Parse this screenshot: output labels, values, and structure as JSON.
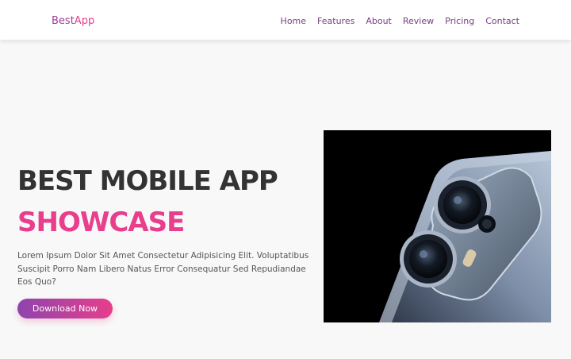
{
  "brand": {
    "part1": "Best",
    "part2": "App"
  },
  "nav": {
    "items": [
      "Home",
      "Features",
      "About",
      "Review",
      "Pricing",
      "Contact"
    ]
  },
  "hero": {
    "title": "BEST MOBILE APP",
    "subtitle": "SHOWCASE",
    "description": "Lorem Ipsum Dolor Sit Amet Consectetur Adipisicing Elit. Voluptatibus Suscipit Porro Nam Libero Natus Error Consequatur Sed Repudiandae Eos Quo?",
    "cta": "Download Now"
  },
  "colors": {
    "brand": "#9b3c96",
    "accent": "#e83e8c",
    "nav_text": "#7a3d86",
    "heading": "#333333",
    "body_text": "#555555",
    "background": "#f8f8f8",
    "button_gradient": [
      "#8e44ad",
      "#e83e8c"
    ]
  },
  "images": {
    "hero": "phone-camera-closeup"
  }
}
